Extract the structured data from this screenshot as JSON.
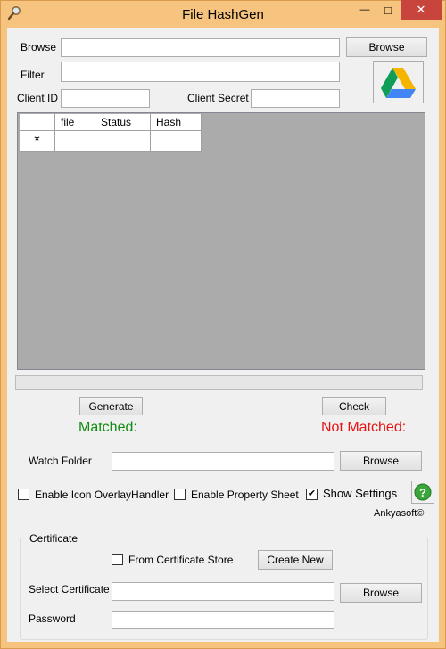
{
  "window": {
    "title": "File HashGen",
    "minimize_glyph": "—",
    "maximize_glyph": "□",
    "close_glyph": "✕",
    "app_icon": "magnifier-icon",
    "accent_color": "#f6c47e",
    "close_color": "#c7453d"
  },
  "form": {
    "browse_label": "Browse",
    "browse_value": "",
    "browse_button": "Browse",
    "filter_label": "Filter",
    "filter_value": "",
    "client_id_label": "Client ID",
    "client_id_value": "",
    "client_secret_label": "Client Secret",
    "client_secret_value": "",
    "drive_button_icon": "google-drive-icon"
  },
  "grid": {
    "columns": [
      "",
      "file",
      "Status",
      "Hash"
    ],
    "new_row_marker": "*",
    "rows": []
  },
  "progress": {
    "value": 0
  },
  "actions": {
    "generate": "Generate",
    "check": "Check",
    "matched": "Matched:",
    "not_matched": "Not Matched:",
    "matched_color": "#128a12",
    "not_matched_color": "#e81010"
  },
  "watch": {
    "label": "Watch Folder",
    "value": "",
    "browse": "Browse"
  },
  "options": {
    "overlay": {
      "label": "Enable Icon OverlayHandler",
      "checked": false
    },
    "property_sheet": {
      "label": "Enable Property Sheet",
      "checked": false
    },
    "show_settings": {
      "label": "Show Settings",
      "checked": true
    },
    "help_icon": "help-question-icon",
    "brand": "Ankyasoft©"
  },
  "certificate": {
    "group_label": "Certificate",
    "from_store": {
      "label": "From Certificate Store",
      "checked": false
    },
    "create_new": "Create New",
    "select_label": "Select Certificate",
    "select_value": "",
    "browse": "Browse",
    "password_label": "Password",
    "password_value": ""
  }
}
